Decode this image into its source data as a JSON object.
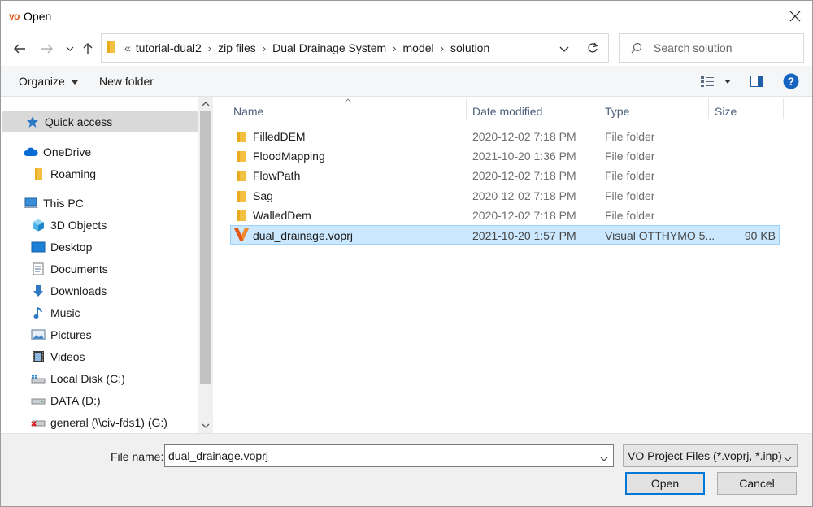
{
  "window": {
    "logo": "vo",
    "title": "Open"
  },
  "address": {
    "crumbs": [
      "tutorial-dual2",
      "zip files",
      "Dual Drainage System",
      "model",
      "solution"
    ],
    "overflow": "«"
  },
  "search": {
    "placeholder": "Search solution"
  },
  "toolbar": {
    "organize_label": "Organize",
    "new_folder_label": "New folder"
  },
  "nav": {
    "quick_access": "Quick access",
    "onedrive": "OneDrive",
    "roaming": "Roaming",
    "this_pc": "This PC",
    "objects3d": "3D Objects",
    "desktop": "Desktop",
    "documents": "Documents",
    "downloads": "Downloads",
    "music": "Music",
    "pictures": "Pictures",
    "videos": "Videos",
    "local_disk": "Local Disk (C:)",
    "data_disk": "DATA (D:)",
    "network_drive": "general (\\\\civ-fds1) (G:)"
  },
  "columns": {
    "name": "Name",
    "date": "Date modified",
    "type": "Type",
    "size": "Size"
  },
  "files": [
    {
      "name": "FilledDEM",
      "date": "2020-12-02 7:18 PM",
      "type": "File folder",
      "size": ""
    },
    {
      "name": "FloodMapping",
      "date": "2021-10-20 1:36 PM",
      "type": "File folder",
      "size": ""
    },
    {
      "name": "FlowPath",
      "date": "2020-12-02 7:18 PM",
      "type": "File folder",
      "size": ""
    },
    {
      "name": "Sag",
      "date": "2020-12-02 7:18 PM",
      "type": "File folder",
      "size": ""
    },
    {
      "name": "WalledDem",
      "date": "2020-12-02 7:18 PM",
      "type": "File folder",
      "size": ""
    },
    {
      "name": "dual_drainage.voprj",
      "date": "2021-10-20 1:57 PM",
      "type": "Visual OTTHYMO 5...",
      "size": "90 KB"
    }
  ],
  "bottom": {
    "filename_label": "File name:",
    "filename_value": "dual_drainage.voprj",
    "filetype_value": "VO Project Files (*.voprj, *.inp)",
    "open_label": "Open",
    "cancel_label": "Cancel"
  },
  "colors": {
    "accent": "#0078d7",
    "selection": "#cce8ff",
    "folder": "#f4c042",
    "vo_orange": "#e0561b"
  }
}
